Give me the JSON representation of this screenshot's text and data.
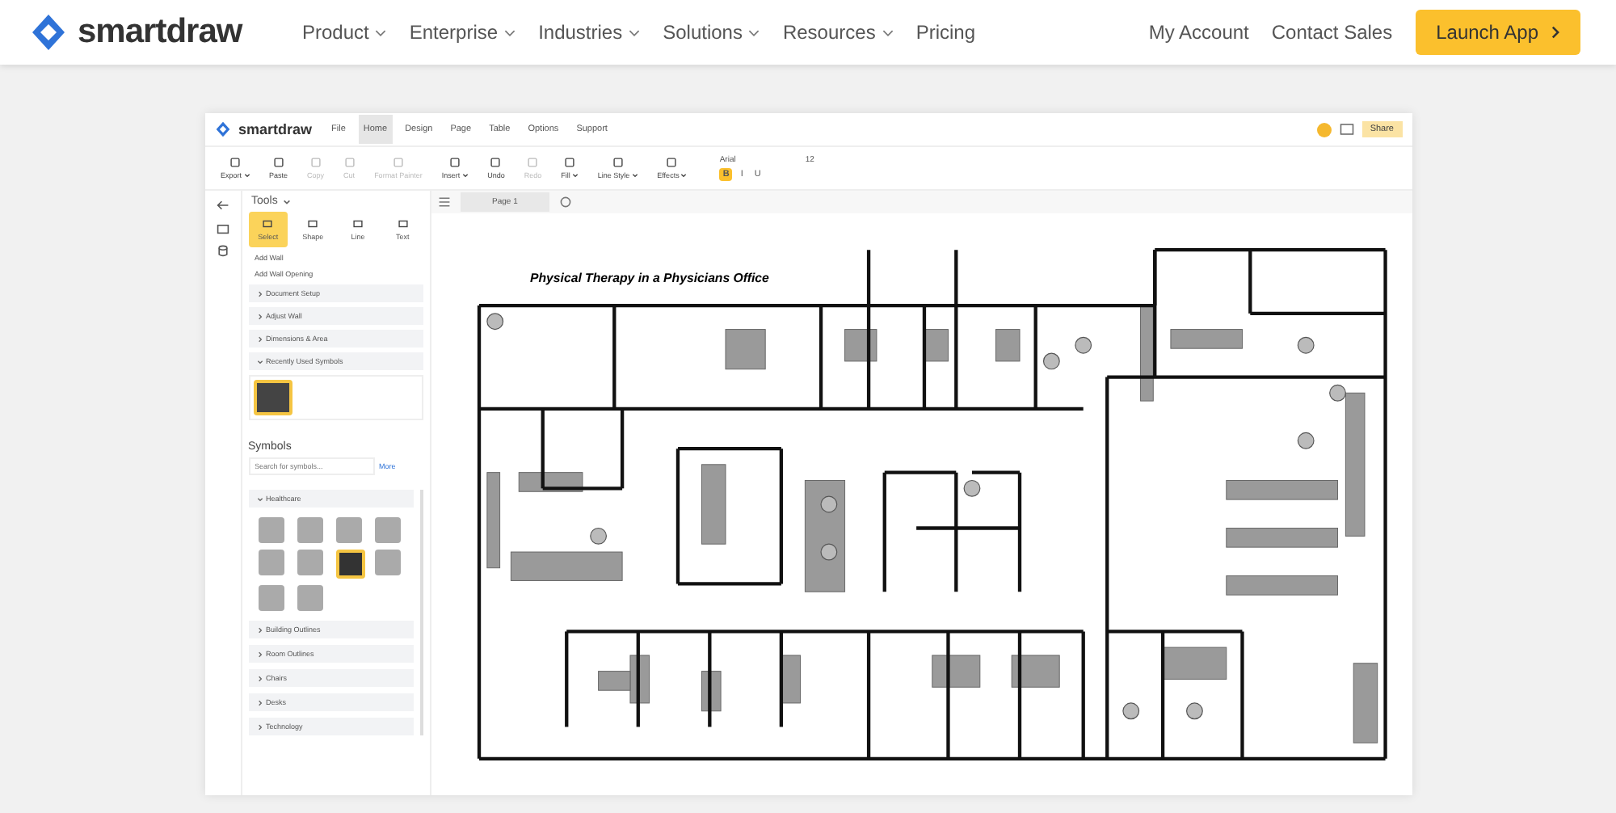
{
  "nav": {
    "brand": "smartdraw",
    "menu": [
      {
        "label": "Product",
        "dropdown": true
      },
      {
        "label": "Enterprise",
        "dropdown": true
      },
      {
        "label": "Industries",
        "dropdown": true
      },
      {
        "label": "Solutions",
        "dropdown": true
      },
      {
        "label": "Resources",
        "dropdown": true
      },
      {
        "label": "Pricing",
        "dropdown": false
      }
    ],
    "links": [
      "My Account",
      "Contact Sales"
    ],
    "cta": "Launch App"
  },
  "app": {
    "brand": "smartdraw",
    "menu": [
      {
        "label": "File",
        "selected": false
      },
      {
        "label": "Home",
        "selected": true
      },
      {
        "label": "Design",
        "selected": false
      },
      {
        "label": "Page",
        "selected": false
      },
      {
        "label": "Table",
        "selected": false
      },
      {
        "label": "Options",
        "selected": false
      },
      {
        "label": "Support",
        "selected": false
      }
    ],
    "share": "Share",
    "toolbar": [
      {
        "label": "Export",
        "disabled": false,
        "caret": true
      },
      {
        "label": "Paste",
        "disabled": false,
        "caret": false
      },
      {
        "label": "Copy",
        "disabled": true,
        "caret": false
      },
      {
        "label": "Cut",
        "disabled": true,
        "caret": false
      },
      {
        "label": "Format Painter",
        "disabled": true,
        "caret": false
      },
      {
        "label": "Insert",
        "disabled": false,
        "caret": true
      },
      {
        "label": "Undo",
        "disabled": false,
        "caret": false
      },
      {
        "label": "Redo",
        "disabled": true,
        "caret": false
      },
      {
        "label": "Fill",
        "disabled": false,
        "caret": true
      },
      {
        "label": "Line Style",
        "disabled": false,
        "caret": true
      },
      {
        "label": "Effects",
        "disabled": false,
        "caret": true
      }
    ],
    "font": {
      "family": "Arial",
      "size": "12"
    },
    "format": [
      {
        "label": "B",
        "selected": true
      },
      {
        "label": "I",
        "selected": false
      },
      {
        "label": "U",
        "selected": false
      }
    ],
    "tools_title": "Tools",
    "tools": [
      {
        "label": "Select",
        "selected": true
      },
      {
        "label": "Shape",
        "selected": false
      },
      {
        "label": "Line",
        "selected": false
      },
      {
        "label": "Text",
        "selected": false
      }
    ],
    "wall_actions": [
      "Add Wall",
      "Add Wall Opening"
    ],
    "sections": [
      {
        "label": "Document Setup",
        "expanded": false
      },
      {
        "label": "Adjust Wall",
        "expanded": false
      },
      {
        "label": "Dimensions & Area",
        "expanded": false
      },
      {
        "label": "Recently Used Symbols",
        "expanded": true
      }
    ],
    "symbols": {
      "title": "Symbols",
      "placeholder": "Search for symbols...",
      "more": "More",
      "libraries": [
        {
          "label": "Healthcare",
          "expanded": true
        },
        {
          "label": "Building Outlines",
          "expanded": false
        },
        {
          "label": "Room Outlines",
          "expanded": false
        },
        {
          "label": "Chairs",
          "expanded": false
        },
        {
          "label": "Desks",
          "expanded": false
        },
        {
          "label": "Technology",
          "expanded": false
        }
      ]
    },
    "page_tab": "Page 1",
    "plan_title": "Physical Therapy in a Physicians Office"
  }
}
